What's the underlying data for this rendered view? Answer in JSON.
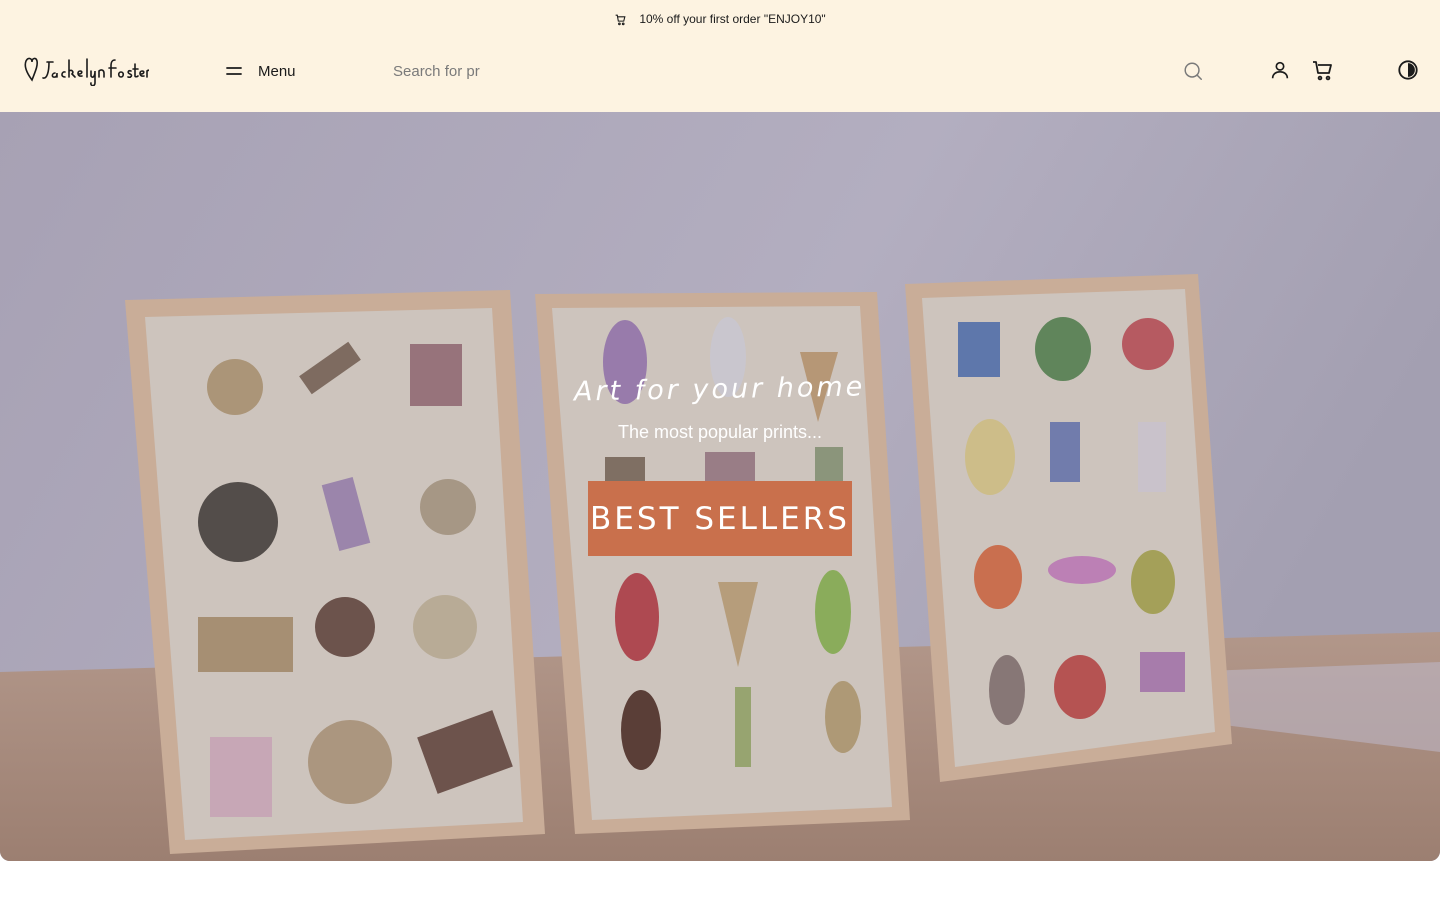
{
  "announcement": {
    "icon": "cart-icon",
    "text": "10% off your first order \"ENJOY10\""
  },
  "header": {
    "logo_alt": "Jackelyn Foster",
    "menu_label": "Menu",
    "search_placeholder": "Search for pr",
    "icons": [
      "search-icon",
      "account-icon",
      "cart-icon",
      "theme-toggle-icon"
    ]
  },
  "hero": {
    "title": "Art for your home",
    "subtitle": "The most popular prints...",
    "button_label": "BEST SELLERS"
  },
  "colors": {
    "announcement_bg": "#fdf3e1",
    "header_bg": "#fdf3e1",
    "button_bg": "#c9704c",
    "wall": "#aca7b8",
    "floor": "#a88b7e"
  }
}
